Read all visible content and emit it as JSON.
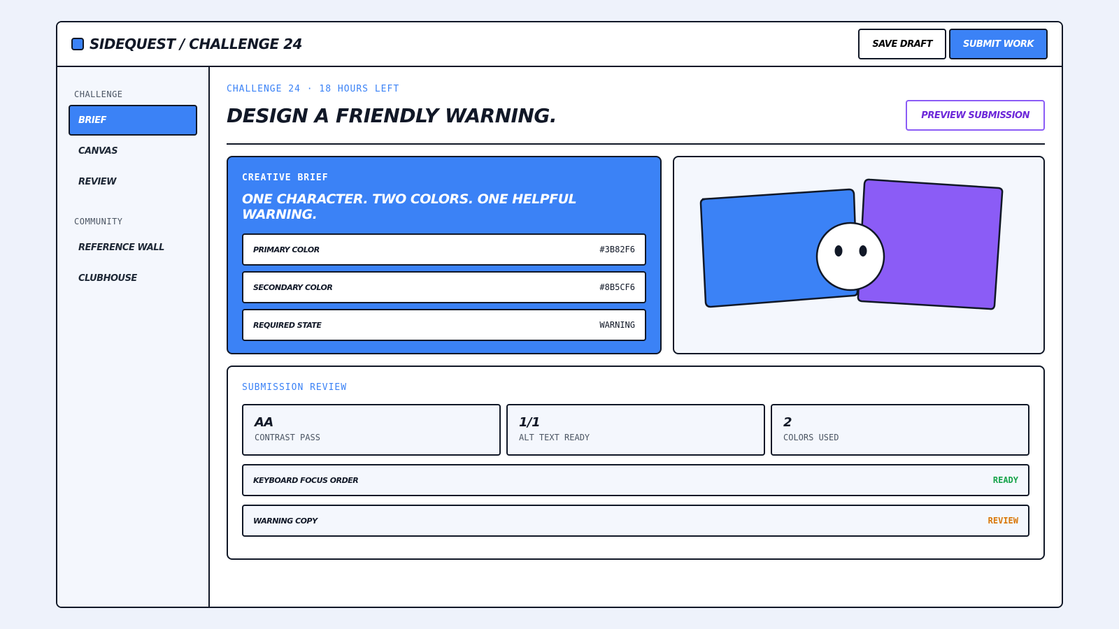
{
  "header": {
    "title": "SIDEQUEST / CHALLENGE 24",
    "save_label": "SAVE DRAFT",
    "submit_label": "SUBMIT WORK"
  },
  "sidebar": {
    "groups": [
      {
        "heading": "CHALLENGE",
        "items": [
          "BRIEF",
          "CANVAS",
          "REVIEW"
        ]
      },
      {
        "heading": "COMMUNITY",
        "items": [
          "REFERENCE WALL",
          "CLUBHOUSE"
        ]
      }
    ],
    "active_item": "BRIEF"
  },
  "main": {
    "kicker": "CHALLENGE 24 · 18 HOURS LEFT",
    "title": "DESIGN A FRIENDLY WARNING.",
    "preview_label": "PREVIEW SUBMISSION"
  },
  "brief": {
    "label": "CREATIVE BRIEF",
    "headline": "ONE CHARACTER. TWO COLORS. ONE HELPFUL WARNING.",
    "specs": [
      {
        "label": "PRIMARY COLOR",
        "value": "#3B82F6"
      },
      {
        "label": "SECONDARY COLOR",
        "value": "#8B5CF6"
      },
      {
        "label": "REQUIRED STATE",
        "value": "WARNING"
      }
    ]
  },
  "review": {
    "label": "SUBMISSION REVIEW",
    "stats": [
      {
        "value": "AA",
        "label": "CONTRAST PASS"
      },
      {
        "value": "1/1",
        "label": "ALT TEXT READY"
      },
      {
        "value": "2",
        "label": "COLORS USED"
      }
    ],
    "checks": [
      {
        "label": "KEYBOARD FOCUS ORDER",
        "status": "READY",
        "color": "#16a34a"
      },
      {
        "label": "WARNING COPY",
        "status": "REVIEW",
        "color": "#d97706"
      }
    ]
  },
  "colors": {
    "primary": "#3B82F6",
    "secondary": "#8B5CF6",
    "ink": "#111827"
  }
}
